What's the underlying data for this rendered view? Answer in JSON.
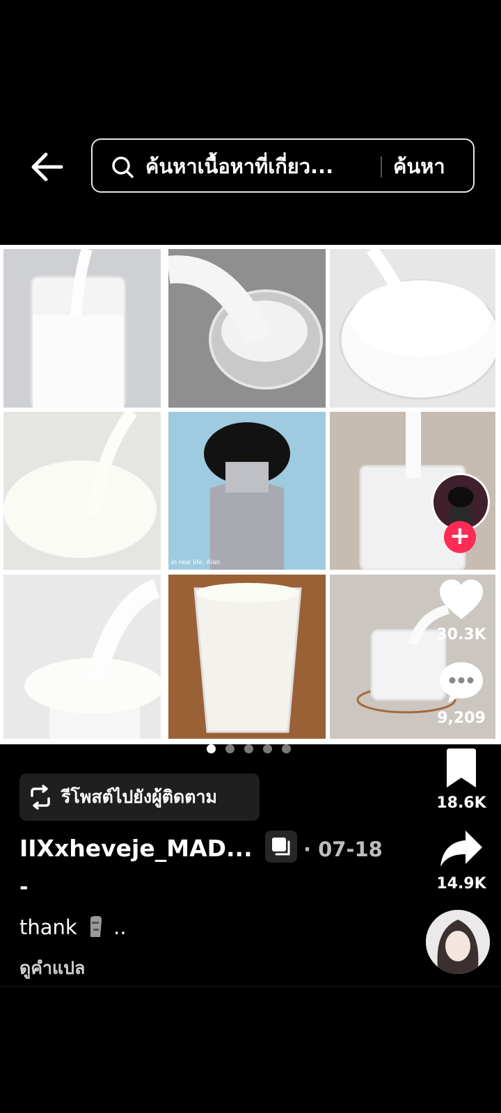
{
  "header": {
    "search_placeholder": "ค้นหาเนื้อหาที่เกี่ยว...",
    "search_button": "ค้นหา"
  },
  "media": {
    "tile_watermark": "in real life. Alan",
    "page_count": 5,
    "current_page": 1
  },
  "rail": {
    "likes": "30.3K",
    "comments": "9,209",
    "saves": "18.6K",
    "shares": "14.9K",
    "follow_symbol": "+"
  },
  "post": {
    "repost_label": "รีโพสต์ไปยังผู้ติดตาม",
    "author": "IIXxheveje_MAD...",
    "date": "· 07-18",
    "dash": "-",
    "caption_text": "thank",
    "caption_suffix": "..",
    "see_translation": "ดูคำแปล"
  },
  "colors": {
    "background": "#000000",
    "follow_red": "#fe2c55"
  }
}
